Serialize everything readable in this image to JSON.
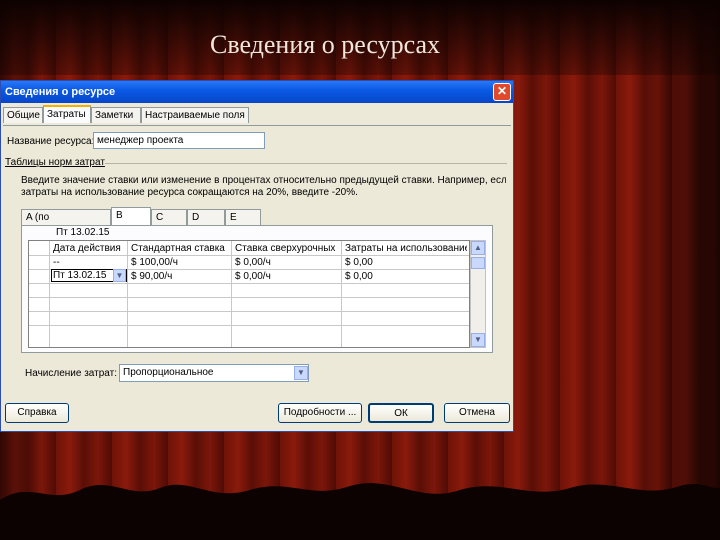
{
  "slide": {
    "title": "Сведения о ресурсах"
  },
  "dialog": {
    "title": "Сведения о ресурсе",
    "close_label": "✕",
    "tabs": [
      {
        "label": "Общие"
      },
      {
        "label": "Затраты"
      },
      {
        "label": "Заметки"
      },
      {
        "label": "Настраиваемые поля"
      }
    ],
    "resource_name_label": "Название ресурса:",
    "resource_name_value": "менеджер проекта",
    "cost_tables_label": "Таблицы норм затрат",
    "instructions": [
      "Введите значение ставки или изменение в процентах относительно предыдущей ставки. Например, если",
      "затраты на использование ресурса сокращаются на 20%, введите -20%."
    ],
    "rate_tabs": [
      {
        "label": "A (по умолчанию)"
      },
      {
        "label": "B"
      },
      {
        "label": "C"
      },
      {
        "label": "D"
      },
      {
        "label": "E"
      }
    ],
    "grid": {
      "edit_value": "Пт 13.02.15",
      "headers": [
        "Дата действия",
        "Стандартная ставка",
        "Ставка сверхурочных",
        "Затраты на использование"
      ],
      "rows": [
        [
          "--",
          "$ 100,00/ч",
          "$ 0,00/ч",
          "$ 0,00"
        ],
        [
          "Пт 13.02.15",
          "$ 90,00/ч",
          "$ 0,00/ч",
          "$ 0,00"
        ]
      ]
    },
    "cost_accrual_label": "Начисление затрат:",
    "cost_accrual_value": "Пропорциональное",
    "buttons": {
      "help": "Справка",
      "details": "Подробности ...",
      "ok": "ОК",
      "cancel": "Отмена"
    }
  },
  "colors": {
    "curtain": "#6e1208",
    "titlebar": "#0a5ae6",
    "dialog_bg": "#ece9d8"
  }
}
